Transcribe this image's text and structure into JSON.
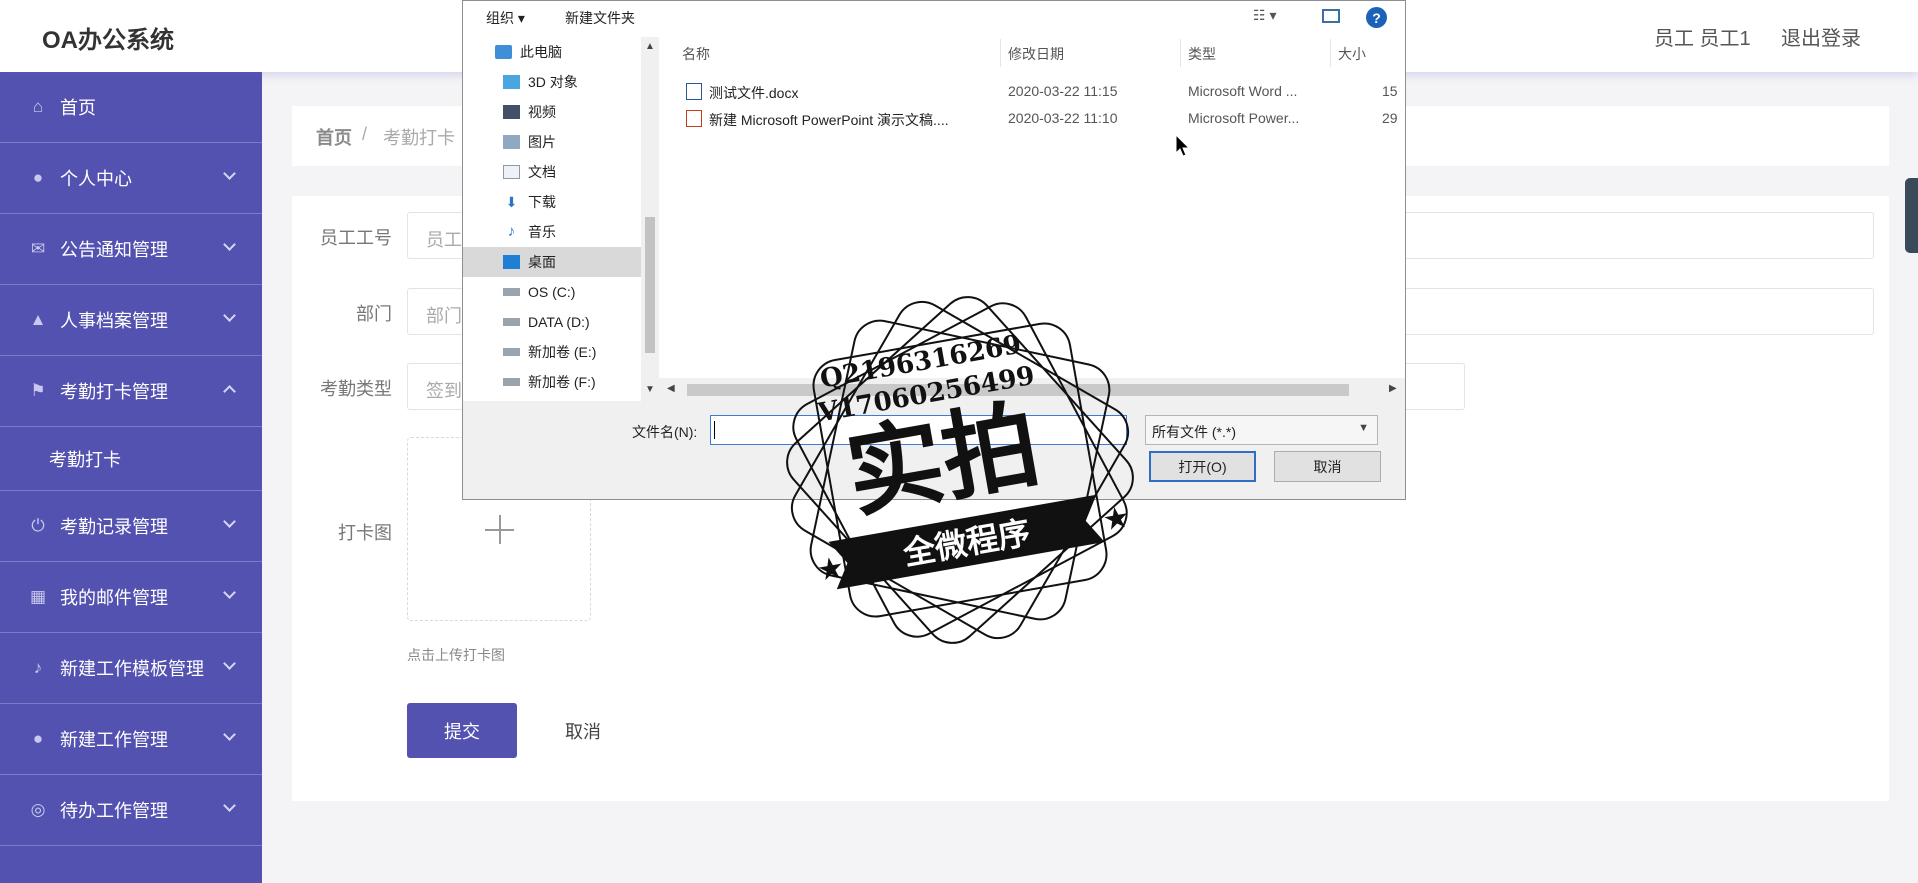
{
  "app": {
    "title": "OA办公系统",
    "user": "员工 员工1",
    "logout": "退出登录"
  },
  "sidebar": {
    "items": [
      {
        "label": "首页",
        "icon": "home-icon"
      },
      {
        "label": "个人中心",
        "icon": "user-icon"
      },
      {
        "label": "公告通知管理",
        "icon": "mail-icon"
      },
      {
        "label": "人事档案管理",
        "icon": "person-icon"
      },
      {
        "label": "考勤打卡管理",
        "icon": "flag-icon",
        "expanded": true
      },
      {
        "label": "考勤记录管理",
        "icon": "power-icon"
      },
      {
        "label": "我的邮件管理",
        "icon": "grid-icon"
      },
      {
        "label": "新建工作模板管理",
        "icon": "mic-icon"
      },
      {
        "label": "新建工作管理",
        "icon": "bulb-icon"
      },
      {
        "label": "待办工作管理",
        "icon": "compass-icon"
      }
    ],
    "sub_item": "考勤打卡"
  },
  "breadcrumb": {
    "home": "首页",
    "sep": "/",
    "current": "考勤打卡"
  },
  "form": {
    "employee_no_label": "员工工号",
    "employee_no_value": "员工",
    "dept_label": "部门",
    "dept_value": "部门",
    "type_label": "考勤类型",
    "type_value": "签到",
    "photo_label": "打卡图",
    "upload_hint": "点击上传打卡图",
    "submit": "提交",
    "cancel": "取消"
  },
  "dialog": {
    "toolbar": {
      "organize": "组织 ▾",
      "new_folder": "新建文件夹",
      "view": "☷ ▾",
      "help": "?"
    },
    "tree": [
      {
        "label": "此电脑",
        "icon": "pc-icon"
      },
      {
        "label": "3D 对象",
        "icon": "cube-icon"
      },
      {
        "label": "视频",
        "icon": "video-icon"
      },
      {
        "label": "图片",
        "icon": "picture-icon"
      },
      {
        "label": "文档",
        "icon": "document-icon"
      },
      {
        "label": "下载",
        "icon": "download-icon"
      },
      {
        "label": "音乐",
        "icon": "music-icon"
      },
      {
        "label": "桌面",
        "icon": "desktop-icon",
        "selected": true
      },
      {
        "label": "OS (C:)",
        "icon": "drive-icon"
      },
      {
        "label": "DATA (D:)",
        "icon": "drive-icon"
      },
      {
        "label": "新加卷 (E:)",
        "icon": "drive-icon"
      },
      {
        "label": "新加卷 (F:)",
        "icon": "drive-icon"
      }
    ],
    "columns": {
      "name": "名称",
      "date": "修改日期",
      "type": "类型",
      "size": "大小"
    },
    "files": [
      {
        "name": "测试文件.docx",
        "date": "2020-03-22 11:15",
        "type": "Microsoft Word ...",
        "size": "15",
        "icon": "word-file-icon"
      },
      {
        "name": "新建 Microsoft PowerPoint 演示文稿....",
        "date": "2020-03-22 11:10",
        "type": "Microsoft Power...",
        "size": "29",
        "icon": "ppt-file-icon"
      }
    ],
    "filename_label": "文件名(N):",
    "filename_value": "",
    "filetype": "所有文件 (*.*)",
    "open": "打开(O)",
    "cancel": "取消"
  },
  "watermark": {
    "line1": "Q2196316269",
    "line2": "V17060256499",
    "main": "实拍",
    "banner": "全微程序"
  }
}
